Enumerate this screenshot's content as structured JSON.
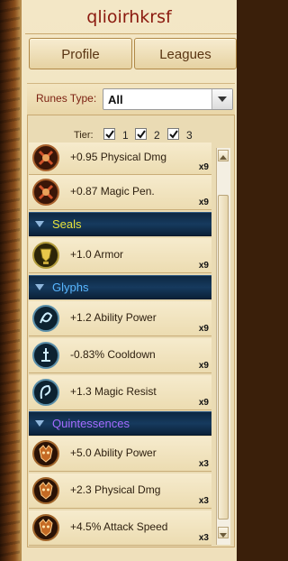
{
  "title": "qlioirhkrsf",
  "tabs": [
    {
      "label": "Profile"
    },
    {
      "label": "Leagues"
    }
  ],
  "filter": {
    "runes_type_label": "Runes Type:",
    "runes_type_value": "All",
    "tier_label": "Tier:",
    "tiers": [
      {
        "value": "1",
        "checked": true
      },
      {
        "value": "2",
        "checked": true
      },
      {
        "value": "3",
        "checked": true
      }
    ]
  },
  "colors": {
    "title": "#8b1a0f",
    "seals_header": "#e6e23a",
    "glyphs_header": "#58b6ff",
    "quintessences_header": "#a56bff"
  },
  "list": {
    "marks": [
      {
        "name": "+0.95 Physical Dmg",
        "qty": "x9",
        "icon": "mark-rune-icon"
      },
      {
        "name": "+0.87 Magic Pen.",
        "qty": "x9",
        "icon": "mark-rune-icon"
      }
    ],
    "seals_label": "Seals",
    "seals": [
      {
        "name": "+1.0 Armor",
        "qty": "x9",
        "icon": "seal-rune-icon"
      }
    ],
    "glyphs_label": "Glyphs",
    "glyphs": [
      {
        "name": "+1.2 Ability Power",
        "qty": "x9",
        "icon": "glyph-rune-icon"
      },
      {
        "name": "-0.83% Cooldown",
        "qty": "x9",
        "icon": "glyph-rune-icon"
      },
      {
        "name": "+1.3 Magic Resist",
        "qty": "x9",
        "icon": "glyph-rune-icon"
      }
    ],
    "quintessences_label": "Quintessences",
    "quintessences": [
      {
        "name": "+5.0 Ability Power",
        "qty": "x3",
        "icon": "quintessence-rune-icon"
      },
      {
        "name": "+2.3 Physical Dmg",
        "qty": "x3",
        "icon": "quintessence-rune-icon"
      },
      {
        "name": "+4.5% Attack Speed",
        "qty": "x3",
        "icon": "quintessence-rune-icon"
      }
    ]
  }
}
